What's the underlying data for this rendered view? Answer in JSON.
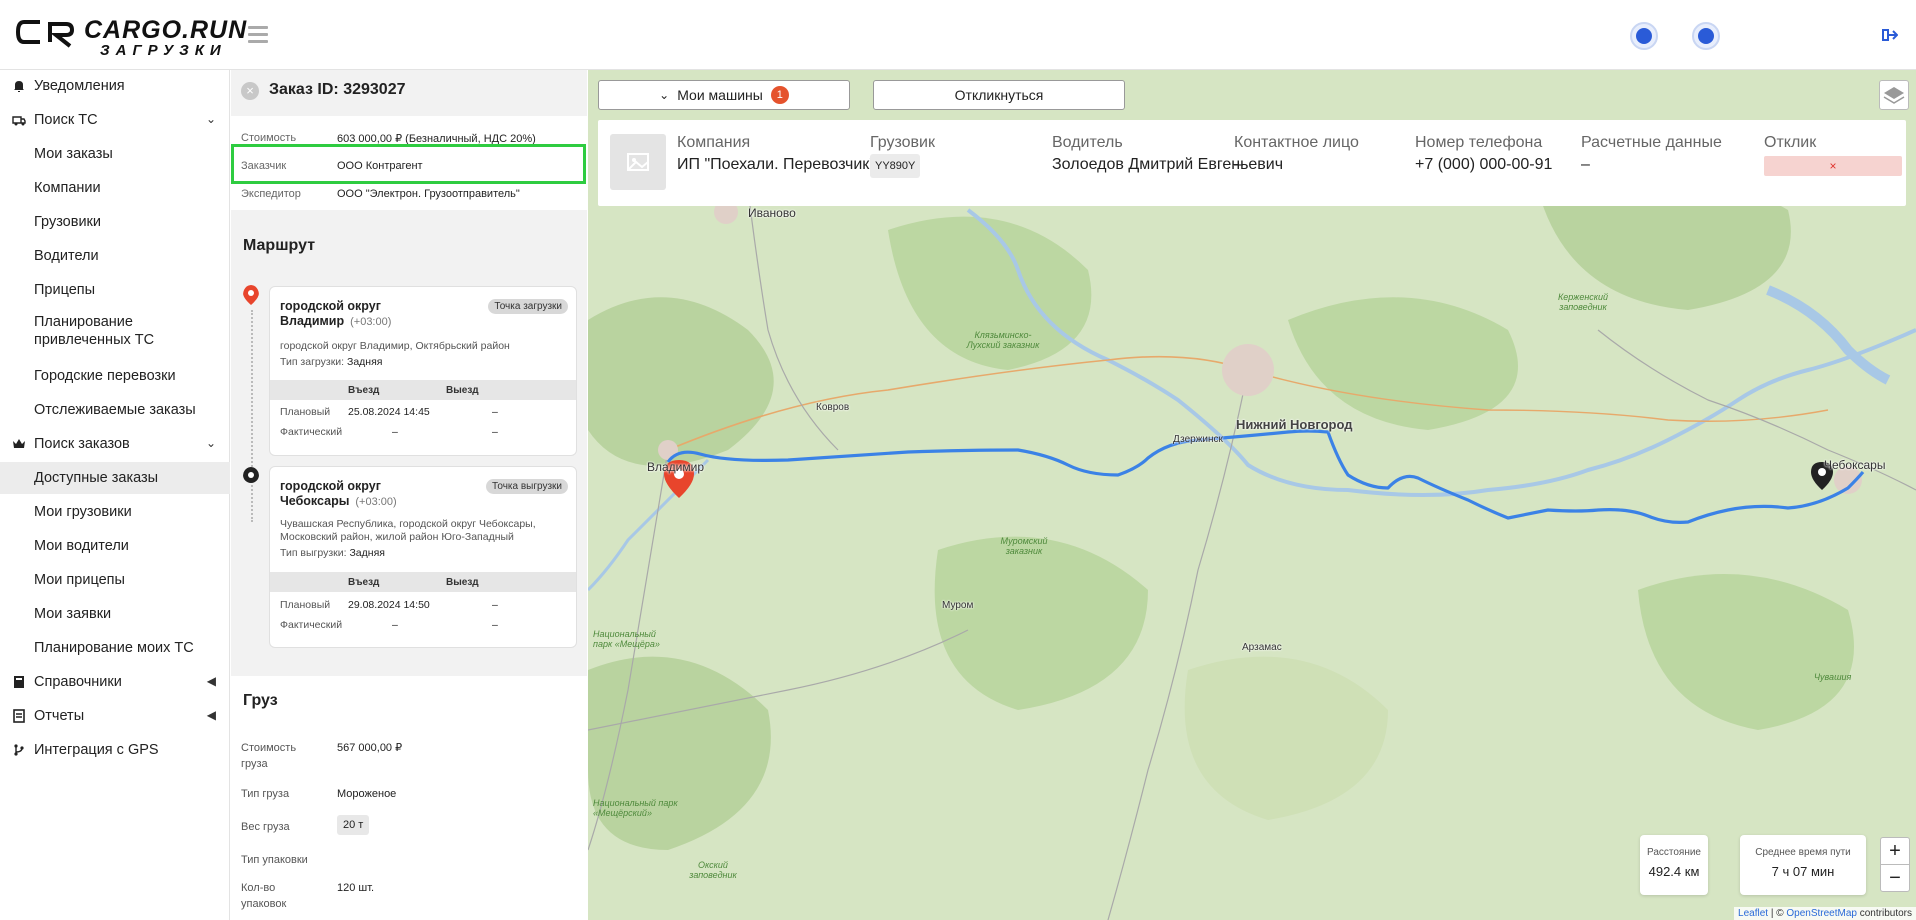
{
  "app": {
    "logo_line1": "CARGO.RUN",
    "logo_line2": "ЗАГРУЗКИ"
  },
  "sidebar": {
    "items": [
      {
        "label": "Уведомления",
        "icon": "bell-icon"
      },
      {
        "label": "Поиск ТС",
        "icon": "truck-icon"
      },
      {
        "label": "Мои заказы"
      },
      {
        "label": "Компании"
      },
      {
        "label": "Грузовики"
      },
      {
        "label": "Водители"
      },
      {
        "label": "Прицепы"
      },
      {
        "label": "Планирование привлеченных ТС"
      },
      {
        "label": "Городские перевозки"
      },
      {
        "label": "Отслеживаемые заказы"
      },
      {
        "label": "Поиск заказов",
        "icon": "crown-icon"
      },
      {
        "label": "Доступные заказы"
      },
      {
        "label": "Мои грузовики"
      },
      {
        "label": "Мои водители"
      },
      {
        "label": "Мои прицепы"
      },
      {
        "label": "Мои заявки"
      },
      {
        "label": "Планирование моих ТС"
      },
      {
        "label": "Справочники",
        "icon": "book-icon"
      },
      {
        "label": "Отчеты",
        "icon": "report-icon"
      },
      {
        "label": "Интеграция с GPS",
        "icon": "branch-icon"
      }
    ]
  },
  "order": {
    "title": "Заказ ID: 3293027",
    "info": [
      {
        "label": "Стоимость",
        "value": "603 000,00 ₽ (Безналичный, НДС 20%)"
      },
      {
        "label": "Заказчик",
        "value": "ООО Контрагент"
      },
      {
        "label": "Экспедитор",
        "value": "ООО \"Электрон. Грузоотправитель\""
      }
    ],
    "route_title": "Маршрут",
    "points": [
      {
        "city_line1": "городской округ",
        "city_line2": "Владимир",
        "tz": "(+03:00)",
        "badge": "Точка загрузки",
        "address": "городской округ Владимир, Октябрьский район",
        "type_label": "Тип загрузки:",
        "type_value": "Задняя",
        "col_in": "Въезд",
        "col_out": "Выезд",
        "plan_label": "Плановый",
        "plan_in": "25.08.2024 14:45",
        "plan_out": "–",
        "fact_label": "Фактический",
        "fact_in": "–",
        "fact_out": "–"
      },
      {
        "city_line1": "городской округ",
        "city_line2": "Чебоксары",
        "tz": "(+03:00)",
        "badge": "Точка выгрузки",
        "address": "Чувашская Республика, городской округ Чебоксары, Московский район, жилой район Юго-Западный",
        "type_label": "Тип выгрузки:",
        "type_value": "Задняя",
        "col_in": "Въезд",
        "col_out": "Выезд",
        "plan_label": "Плановый",
        "plan_in": "29.08.2024 14:50",
        "plan_out": "–",
        "fact_label": "Фактический",
        "fact_in": "–",
        "fact_out": "–"
      }
    ],
    "cargo_title": "Груз",
    "cargo": [
      {
        "label": "Стоимость груза",
        "value": "567 000,00 ₽"
      },
      {
        "label": "Тип груза",
        "value": "Мороженое"
      },
      {
        "label": "Вес груза",
        "value": "20 т"
      },
      {
        "label": "Тип упаковки",
        "value": ""
      },
      {
        "label": "Кол-во упаковок",
        "value": "120 шт."
      }
    ]
  },
  "map": {
    "my_cars_label": "Мои машины",
    "my_cars_count": "1",
    "respond_label": "Откликнуться",
    "table": {
      "headers": [
        "Компания",
        "Грузовик",
        "Водитель",
        "Контактное лицо",
        "Номер телефона",
        "Расчетные данные",
        "Отклик"
      ],
      "company": "ИП \"Поехали. Перевозчик\"",
      "truck": "YY890Y",
      "driver": "Золоедов Дмитрий Евгеньевич",
      "contact": "–",
      "phone": "+7 (000) 000-00-91",
      "payment": "–",
      "reject": "×"
    },
    "cities": {
      "ivanovo": "Иваново",
      "kovrov": "Ковров",
      "nn": "Нижний Новгород",
      "dzerzhinsk": "Дзержинск",
      "vladimir": "Владимир",
      "cheboksary": "Чебоксары",
      "murom": "Муром",
      "arzamas": "Арзамас"
    },
    "reserves": {
      "klyazma": "Клязьминско-Лухский заказник",
      "kerzhensky": "Керженский заповедник",
      "murom_res": "Муромский заказник",
      "meshchera1": "Национальный парк «Мещёра»",
      "meshchera2": "Национальный парк «Мещёрский»",
      "oksky": "Окский заповедник",
      "chuvashia": "Чувашия"
    },
    "distance_label": "Расстояние",
    "distance_value": "492.4 км",
    "time_label": "Среднее время пути",
    "time_value": "7 ч 07 мин",
    "zoom_in": "+",
    "zoom_out": "−",
    "attr_leaflet": "Leaflet",
    "attr_sep": " | © ",
    "attr_osm": "OpenStreetMap",
    "attr_rest": " contributors"
  },
  "colors": {
    "route": "#3b82e6",
    "highlight": "#2ecc40",
    "start_pin": "#e8452c",
    "end_pin": "#222222"
  }
}
